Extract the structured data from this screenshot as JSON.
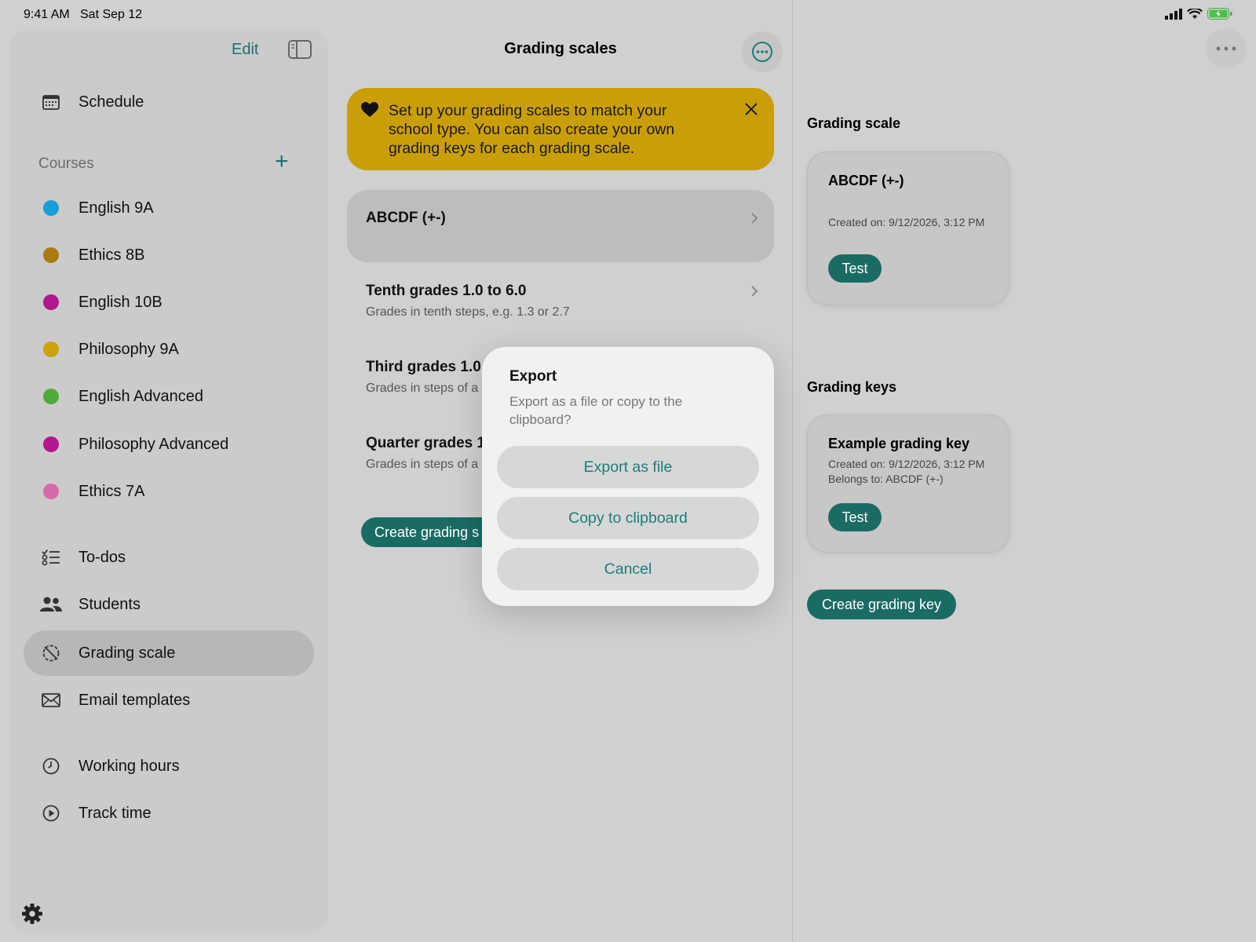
{
  "status": {
    "time": "9:41 AM",
    "date": "Sat Sep 12"
  },
  "sidebar": {
    "edit_label": "Edit",
    "courses_header": "Courses",
    "add_label": "+",
    "top_items": [
      {
        "label": "Schedule",
        "icon": "calendar-icon"
      }
    ],
    "courses": [
      {
        "label": "English 9A",
        "color": "#1a9cd6"
      },
      {
        "label": "Ethics 8B",
        "color": "#a87a14"
      },
      {
        "label": "English 10B",
        "color": "#b0188e"
      },
      {
        "label": "Philosophy 9A",
        "color": "#c9a20c"
      },
      {
        "label": "English Advanced",
        "color": "#4faa3c"
      },
      {
        "label": "Philosophy Advanced",
        "color": "#b2178d"
      },
      {
        "label": "Ethics 7A",
        "color": "#d46aa8"
      }
    ],
    "tools": [
      {
        "label": "To-dos",
        "icon": "checklist-icon"
      },
      {
        "label": "Students",
        "icon": "people-icon"
      },
      {
        "label": "Grading scale",
        "icon": "grading-icon",
        "active": true
      },
      {
        "label": "Email templates",
        "icon": "envelope-icon"
      }
    ],
    "time_items": [
      {
        "label": "Working hours",
        "icon": "clock-icon"
      },
      {
        "label": "Track time",
        "icon": "play-circle-icon"
      }
    ]
  },
  "middle": {
    "title": "Grading scales",
    "banner": "Set up your grading scales to match your school type. You can also create your own grading keys for each grading scale.",
    "scales": [
      {
        "title": "ABCDF (+-)",
        "subtitle": ""
      },
      {
        "title": "Tenth grades 1.0 to 6.0",
        "subtitle": "Grades in tenth steps, e.g. 1.3 or 2.7"
      },
      {
        "title": "Third grades 1.0 t",
        "subtitle": "Grades in steps of a"
      },
      {
        "title": "Quarter grades 1",
        "subtitle": "Grades in steps of a"
      }
    ],
    "create_label": "Create grading s"
  },
  "detail": {
    "scale_header": "Grading scale",
    "scale_card": {
      "title": "ABCDF (+-)",
      "created": "Created on: 9/12/2026, 3:12 PM",
      "test_label": "Test"
    },
    "keys_header": "Grading keys",
    "key_card": {
      "title": "Example grading key",
      "created": "Created on: 9/12/2026, 3:12 PM",
      "belongs": "Belongs to: ABCDF (+-)",
      "test_label": "Test"
    },
    "create_key_label": "Create grading key"
  },
  "dialog": {
    "title": "Export",
    "message": "Export as a file or copy to the clipboard?",
    "export_file": "Export as file",
    "copy": "Copy to clipboard",
    "cancel": "Cancel"
  },
  "colors": {
    "accent": "#1b6b65",
    "banner": "#c99e07"
  }
}
